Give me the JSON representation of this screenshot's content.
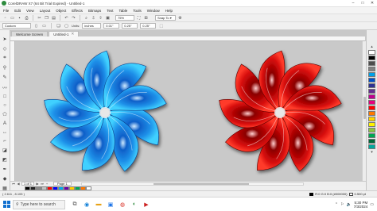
{
  "window": {
    "title": "CorelDRAW X7 (64 Bit Trial Expired) - Untitled-1",
    "controls": [
      "–",
      "□",
      "✕"
    ]
  },
  "menu": {
    "items": [
      "File",
      "Edit",
      "View",
      "Layout",
      "Object",
      "Effects",
      "Bitmaps",
      "Text",
      "Table",
      "Tools",
      "Window",
      "Help"
    ]
  },
  "toolbar": {
    "zoom": "75%",
    "snap": "Snap To ▾"
  },
  "property_bar": {
    "preset": "Custom",
    "units_label": "Units:",
    "units": "inches",
    "nudge": "0.01\"",
    "dup_x": "0.25\"",
    "dup_y": "0.25\""
  },
  "tabs": [
    {
      "label": "Welcome Screen",
      "active": false
    },
    {
      "label": "Untitled-1",
      "active": true
    }
  ],
  "page_nav": {
    "counter": "1 of 1",
    "page_tab": "Page 1"
  },
  "status": {
    "coords": "( 2.611 , 8.105 )",
    "fill": "R:0 G:0 B:0 (#000000)",
    "outline": "0.500 pt"
  },
  "taskbar": {
    "search_placeholder": "Type here to search",
    "time": "5:30 PM",
    "date": "7/3/2024"
  },
  "colors": {
    "blue_star": "#1e8fe8",
    "red_star": "#d40a0a",
    "canvas": "#c9c9c9"
  },
  "palette": [
    "#ffffff",
    "#000000",
    "#4d4d4d",
    "#808080",
    "#00a0e8",
    "#0050c8",
    "#2e3192",
    "#662d91",
    "#c00090",
    "#e6007e",
    "#ff0000",
    "#ff7700",
    "#ffd200",
    "#fff200",
    "#8cc63f",
    "#00a651",
    "#006838",
    "#00a99d"
  ],
  "palette_bottom": [
    "#000000",
    "#222222",
    "#8a8a8a",
    "#c2c2c2",
    "#ff0000",
    "#0000ff",
    "#00aaee",
    "#6a00aa",
    "#ffcc00",
    "#00aa55",
    "#ff7700",
    "#ffffff"
  ]
}
